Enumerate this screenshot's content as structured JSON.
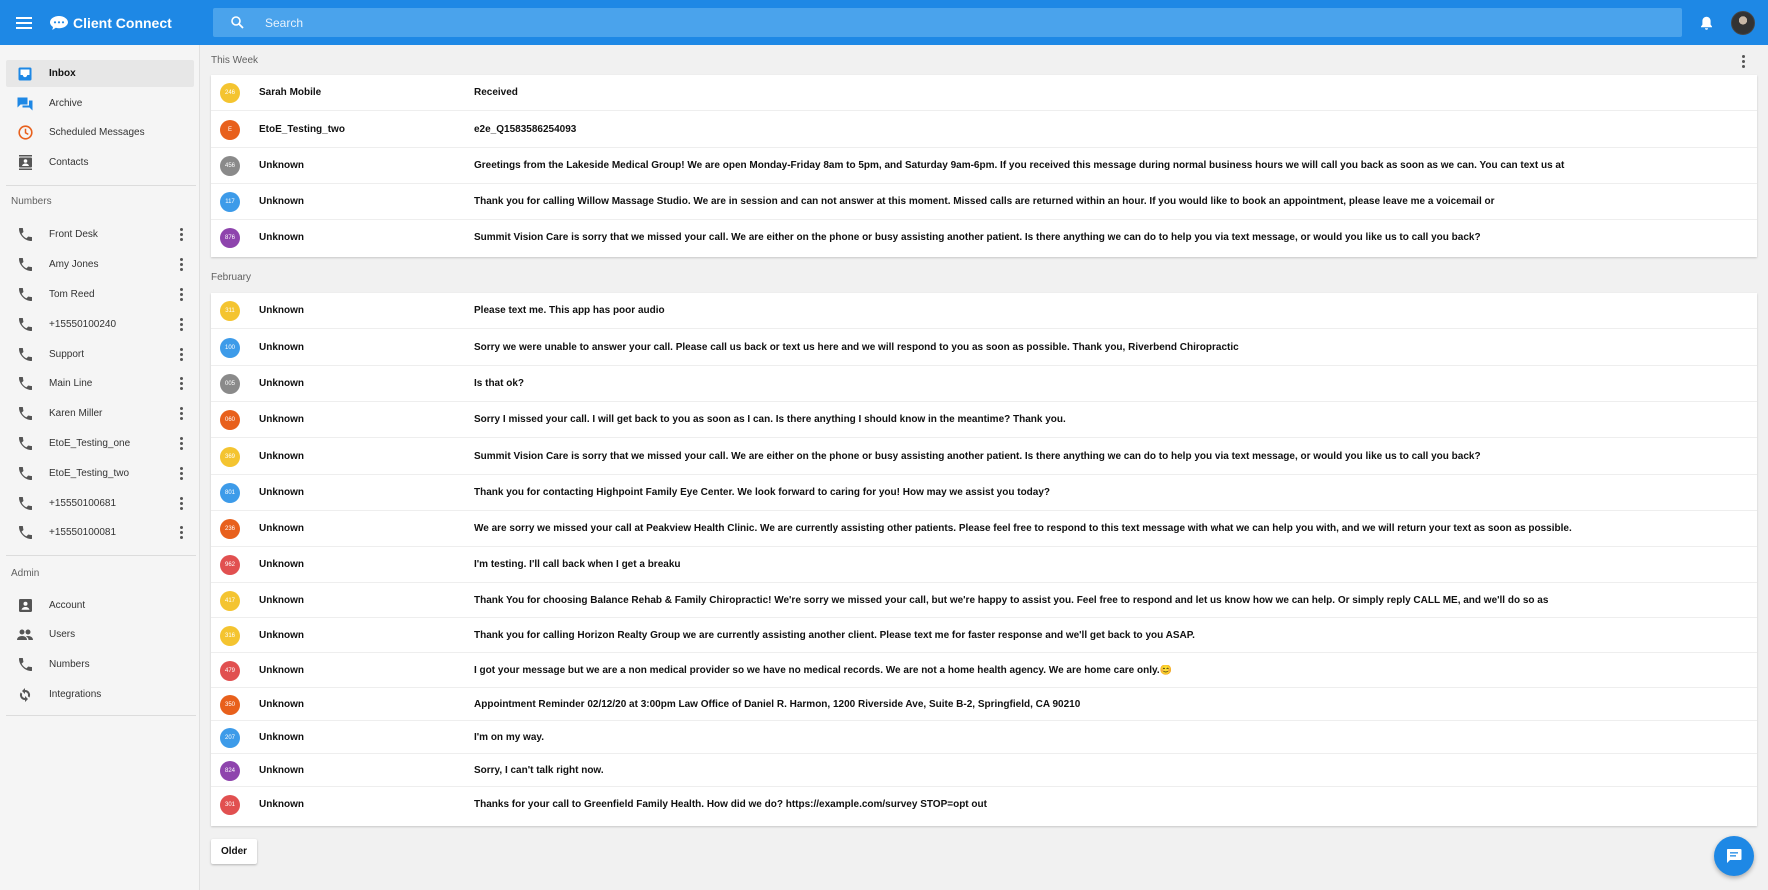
{
  "app": {
    "title": "Client Connect"
  },
  "search": {
    "placeholder": "Search"
  },
  "sidebar": {
    "nav": [
      {
        "label": "Inbox",
        "icon": "inbox-icon",
        "active": true
      },
      {
        "label": "Archive",
        "icon": "archive-icon"
      },
      {
        "label": "Scheduled Messages",
        "icon": "clock-icon"
      },
      {
        "label": "Contacts",
        "icon": "contacts-icon"
      }
    ],
    "numbers_title": "Numbers",
    "numbers": [
      {
        "label": "Front Desk"
      },
      {
        "label": "Amy Jones"
      },
      {
        "label": "Tom Reed"
      },
      {
        "label": "+15550100240"
      },
      {
        "label": "Support"
      },
      {
        "label": "Main Line"
      },
      {
        "label": "Karen Miller"
      },
      {
        "label": "EtoE_Testing_one"
      },
      {
        "label": "EtoE_Testing_two"
      },
      {
        "label": "+15550100681"
      },
      {
        "label": "+15550100081"
      }
    ],
    "admin_title": "Admin",
    "admin": [
      {
        "label": "Account",
        "icon": "account-box-icon"
      },
      {
        "label": "Users",
        "icon": "users-icon"
      },
      {
        "label": "Numbers",
        "icon": "phone-icon"
      },
      {
        "label": "Integrations",
        "icon": "sync-icon"
      }
    ]
  },
  "colors": {
    "primary": "#1e88e5",
    "yellow": "#f4c430",
    "orange": "#e8601c",
    "grey": "#8a8a8a",
    "blue": "#3d9be9",
    "purple": "#8e44ad",
    "red": "#e15050"
  },
  "groups": [
    {
      "title": "This Week",
      "rows": [
        {
          "badge": "246",
          "color": "#f4c430",
          "name": "Sarah Mobile",
          "message": "Received"
        },
        {
          "badge": "E",
          "color": "#e8601c",
          "name": "EtoE_Testing_two",
          "message": "e2e_Q1583586254093"
        },
        {
          "badge": "456",
          "color": "#8a8a8a",
          "name": "Unknown",
          "message": "Greetings from the Lakeside Medical Group! We are open Monday-Friday 8am to 5pm, and Saturday 9am-6pm. If you received this message during normal business hours we will call you back as soon as we can. You can text us at"
        },
        {
          "badge": "117",
          "color": "#3d9be9",
          "name": "Unknown",
          "message": "Thank you for calling Willow Massage Studio. We are in session and can not answer at this moment. Missed calls are returned within an hour. If you would like to book an appointment, please leave me a voicemail or"
        },
        {
          "badge": "876",
          "color": "#8e44ad",
          "name": "Unknown",
          "message": "Summit Vision Care is sorry that we missed your call. We are either on the phone or busy assisting another patient. Is there anything we can do to help you via text message, or would you like us to call you back?"
        }
      ]
    },
    {
      "title": "February",
      "rows": [
        {
          "badge": "311",
          "color": "#f4c430",
          "name": "Unknown",
          "message": "Please text me. This app has poor audio"
        },
        {
          "badge": "100",
          "color": "#3d9be9",
          "name": "Unknown",
          "message": "Sorry we were unable to answer your call. Please call us back or text us here and we will respond to you as soon as possible. Thank you, Riverbend Chiropractic"
        },
        {
          "badge": "005",
          "color": "#8a8a8a",
          "name": "Unknown",
          "message": "Is that ok?"
        },
        {
          "badge": "060",
          "color": "#e8601c",
          "name": "Unknown",
          "message": "Sorry I missed your call. I will get back to you as soon as I can. Is there anything I should know in the meantime? Thank you."
        },
        {
          "badge": "369",
          "color": "#f4c430",
          "name": "Unknown",
          "message": "Summit Vision Care is sorry that we missed your call. We are either on the phone or busy assisting another patient. Is there anything we can do to help you via text message, or would you like us to call you back?"
        },
        {
          "badge": "801",
          "color": "#3d9be9",
          "name": "Unknown",
          "message": "Thank you for contacting Highpoint Family Eye Center. We look forward to caring for you! How may we assist you today?"
        },
        {
          "badge": "236",
          "color": "#e8601c",
          "name": "Unknown",
          "message": "We are sorry we missed your call at Peakview Health Clinic. We are currently assisting other patients. Please feel free to respond to this text message with what we can help you with, and we will return your text as soon as possible."
        },
        {
          "badge": "962",
          "color": "#e15050",
          "name": "Unknown",
          "message": "I'm testing. I'll call back when I get a breaku"
        },
        {
          "badge": "417",
          "color": "#f4c430",
          "name": "Unknown",
          "message": "Thank You for choosing Balance Rehab & Family Chiropractic! We're sorry we missed your call, but we're happy to assist you. Feel free to respond and let us know how we can help. Or simply reply CALL ME, and we'll do so as"
        },
        {
          "badge": "316",
          "color": "#f4c430",
          "name": "Unknown",
          "message": "Thank you for calling Horizon Realty Group we are currently assisting another client. Please text me for faster response and we'll get back to you ASAP."
        },
        {
          "badge": "479",
          "color": "#e15050",
          "name": "Unknown",
          "message": "I got your message but we are a non medical provider so we have no medical records. We are not a home health agency. We are home care only.😊"
        },
        {
          "badge": "350",
          "color": "#e8601c",
          "name": "Unknown",
          "message": "Appointment Reminder 02/12/20 at 3:00pm Law Office of Daniel R. Harmon, 1200 Riverside Ave, Suite B-2, Springfield, CA 90210"
        },
        {
          "badge": "207",
          "color": "#3d9be9",
          "name": "Unknown",
          "message": "I'm on my way."
        },
        {
          "badge": "824",
          "color": "#8e44ad",
          "name": "Unknown",
          "message": "Sorry, I can't talk right now."
        },
        {
          "badge": "301",
          "color": "#e15050",
          "name": "Unknown",
          "message": "Thanks for your call to Greenfield Family Health. How did we do? https://example.com/survey STOP=opt out"
        }
      ]
    }
  ],
  "footer": {
    "older_label": "Older"
  }
}
